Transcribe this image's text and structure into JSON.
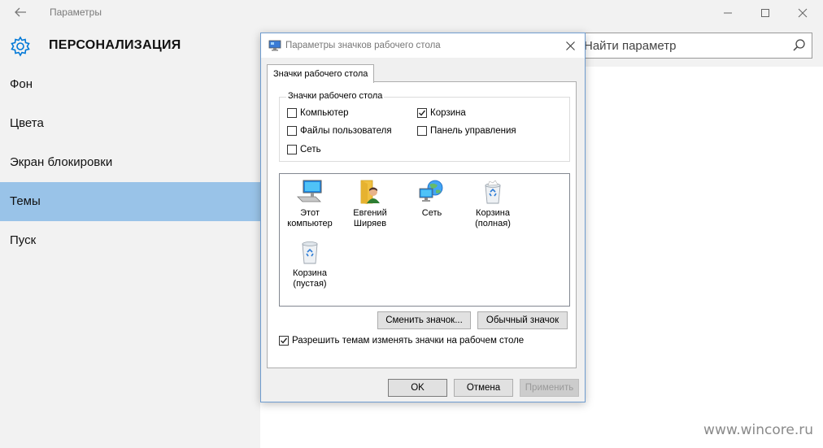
{
  "window": {
    "app_title": "Параметры"
  },
  "settings": {
    "section_title": "ПЕРСОНАЛИЗАЦИЯ",
    "nav": [
      {
        "label": "Фон"
      },
      {
        "label": "Цвета"
      },
      {
        "label": "Экран блокировки"
      },
      {
        "label": "Темы",
        "active": true
      },
      {
        "label": "Пуск"
      }
    ],
    "search_placeholder": "Найти параметр"
  },
  "dialog": {
    "title": "Параметры значков рабочего стола",
    "tab_label": "Значки рабочего стола",
    "group_label": "Значки рабочего стола",
    "checkboxes": [
      {
        "label": "Компьютер",
        "checked": false
      },
      {
        "label": "Корзина",
        "checked": true
      },
      {
        "label": "Файлы пользователя",
        "checked": false
      },
      {
        "label": "Панель управления",
        "checked": false
      },
      {
        "label": "Сеть",
        "checked": false
      }
    ],
    "icons": [
      {
        "label_line1": "Этот",
        "label_line2": "компьютер",
        "icon": "computer-icon"
      },
      {
        "label_line1": "Евгений",
        "label_line2": "Ширяев",
        "icon": "user-folder-icon"
      },
      {
        "label_line1": "Сеть",
        "label_line2": "",
        "icon": "network-icon"
      },
      {
        "label_line1": "Корзина",
        "label_line2": "(полная)",
        "icon": "recycle-bin-full-icon"
      },
      {
        "label_line1": "Корзина",
        "label_line2": "(пустая)",
        "icon": "recycle-bin-empty-icon"
      }
    ],
    "change_icon_button": "Сменить значок...",
    "default_icon_button": "Обычный значок",
    "allow_themes_label": "Разрешить темам изменять значки на рабочем столе",
    "allow_themes_checked": true,
    "ok_button": "OK",
    "cancel_button": "Отмена",
    "apply_button": "Применить"
  },
  "watermark": "www.wincore.ru",
  "colors": {
    "accent": "#0078d7",
    "active_nav": "#99c3e8"
  }
}
